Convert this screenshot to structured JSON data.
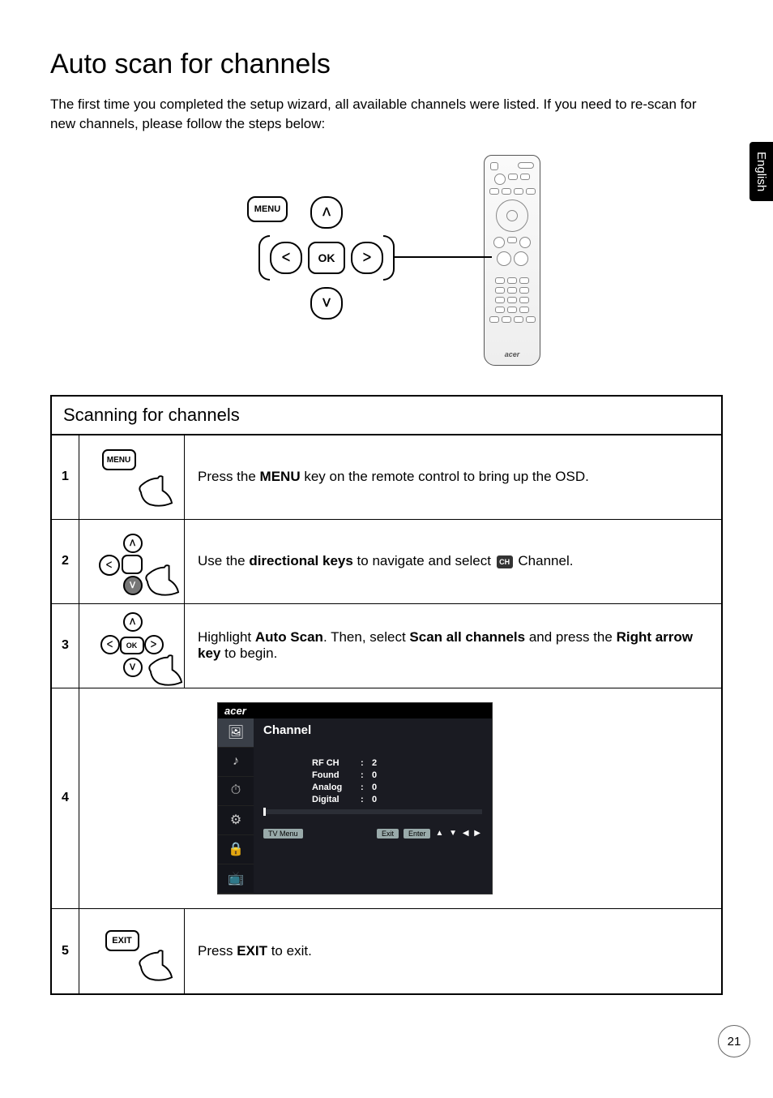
{
  "title": "Auto scan for channels",
  "intro": "The first time you completed the setup wizard, all available channels were listed. If you need to re-scan for new channels, please follow the steps below:",
  "side_tab": "English",
  "page_number": "21",
  "remote_brand": "acer",
  "dpad": {
    "menu": "MENU",
    "ok": "OK",
    "up": "ᐱ",
    "down": "ᐯ",
    "left": "ᐸ",
    "right": "ᐳ"
  },
  "table_title": "Scanning for channels",
  "steps": [
    {
      "num": "1",
      "img_main": "MENU",
      "desc_pre": "Press the ",
      "desc_bold1": "MENU",
      "desc_post": " key on the remote control to bring up the OSD."
    },
    {
      "num": "2",
      "desc_pre": "Use the ",
      "desc_bold1": "directional keys",
      "desc_mid": " to navigate and select ",
      "icon": "CH",
      "desc_post": " Channel."
    },
    {
      "num": "3",
      "desc_pre": "Highlight ",
      "desc_bold1": "Auto Scan",
      "desc_mid": ". Then, select ",
      "desc_bold2": "Scan all channels",
      "desc_mid2": " and press the ",
      "desc_bold3": "Right arrow key",
      "desc_post": " to begin."
    },
    {
      "num": "4",
      "osd": {
        "brand": "acer",
        "title": "Channel",
        "fields": [
          {
            "label": "RF CH",
            "value": "2"
          },
          {
            "label": "Found",
            "value": "0"
          },
          {
            "label": "Analog",
            "value": "0"
          },
          {
            "label": "Digital",
            "value": "0"
          }
        ],
        "footer": {
          "menu": "TV Menu",
          "exit": "Exit",
          "enter": "Enter",
          "arrows": "▲ ▼   ◀ ▶"
        }
      }
    },
    {
      "num": "5",
      "img_main": "EXIT",
      "desc_pre": "Press ",
      "desc_bold1": "EXIT",
      "desc_post": " to exit."
    }
  ]
}
